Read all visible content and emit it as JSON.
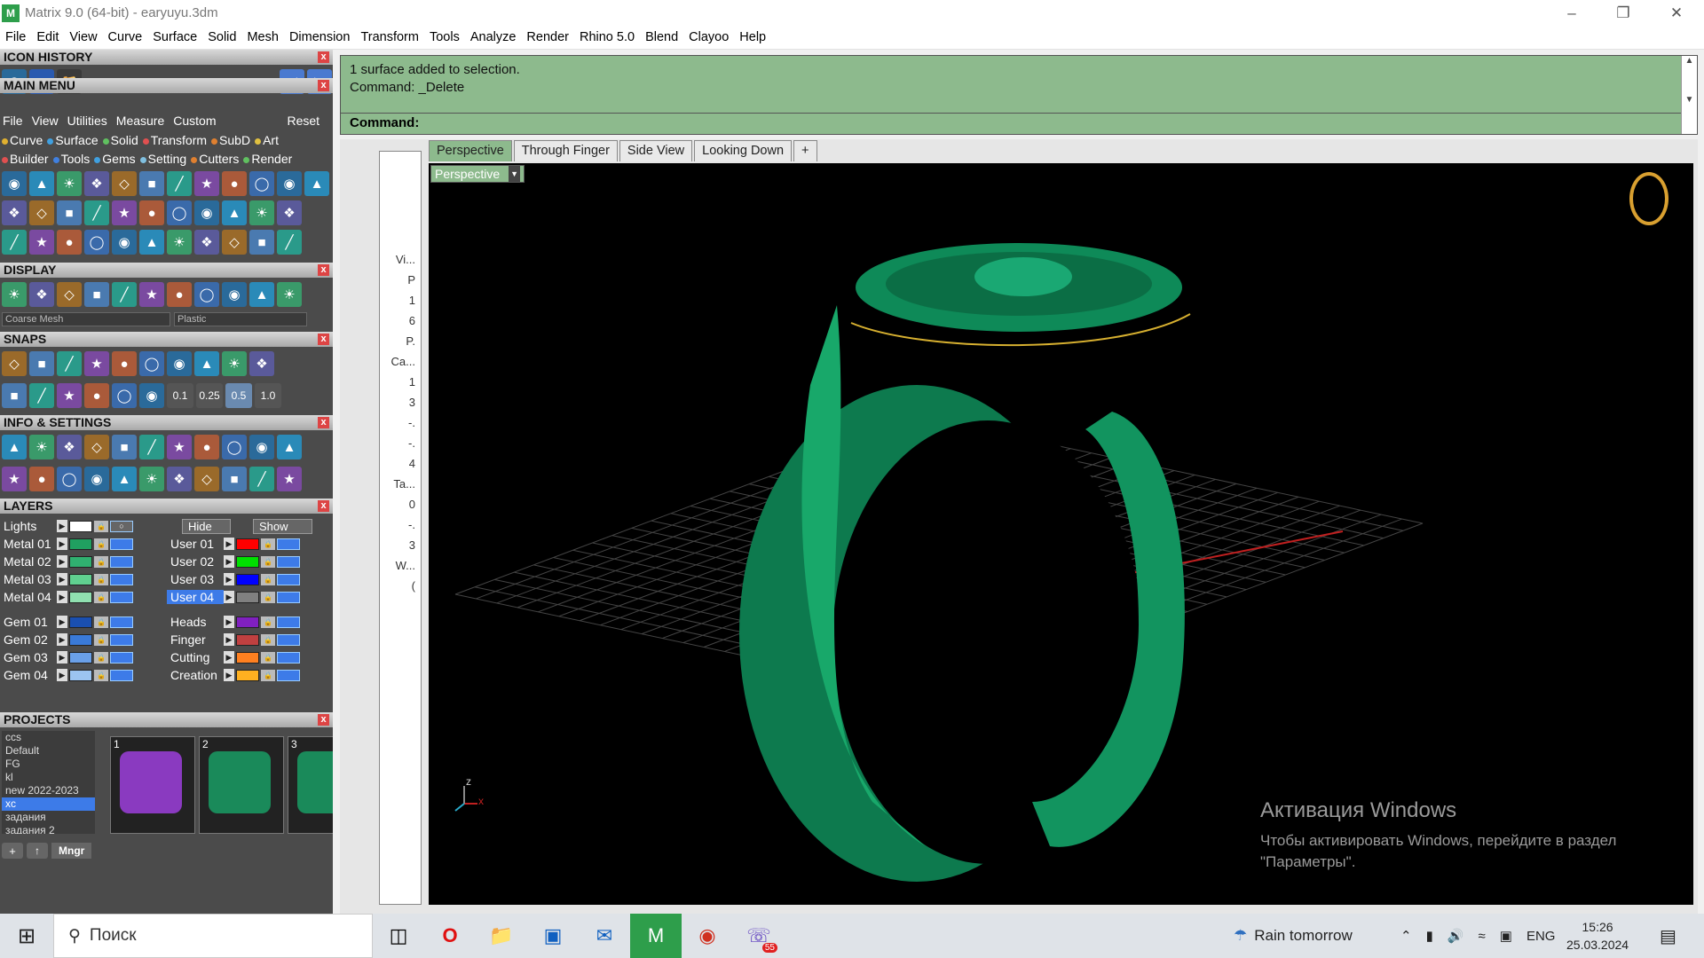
{
  "window": {
    "title": "Matrix 9.0 (64-bit) - earyuyu.3dm",
    "app_icon": "M"
  },
  "menubar": [
    "File",
    "Edit",
    "View",
    "Curve",
    "Surface",
    "Solid",
    "Mesh",
    "Dimension",
    "Transform",
    "Tools",
    "Analyze",
    "Render",
    "Rhino 5.0",
    "Blend",
    "Clayoo",
    "Help"
  ],
  "panels": {
    "icon_history": "ICON HISTORY",
    "main_menu": "MAIN MENU",
    "display": "DISPLAY",
    "snaps": "SNAPS",
    "info": "INFO & SETTINGS",
    "layers": "LAYERS",
    "projects": "PROJECTS"
  },
  "main_menu_items": [
    "File",
    "View",
    "Utilities",
    "Measure",
    "Custom",
    "Reset"
  ],
  "categories_row1": [
    {
      "label": "Curve",
      "color": "#e0b030"
    },
    {
      "label": "Surface",
      "color": "#40a0e0"
    },
    {
      "label": "Solid",
      "color": "#60c060"
    },
    {
      "label": "Transform",
      "color": "#e05050"
    },
    {
      "label": "SubD",
      "color": "#e08030"
    },
    {
      "label": "Art",
      "color": "#e0c040"
    }
  ],
  "categories_row2": [
    {
      "label": "Builder",
      "color": "#e05050"
    },
    {
      "label": "Tools",
      "color": "#4080e0"
    },
    {
      "label": "Gems",
      "color": "#40a0e0"
    },
    {
      "label": "Setting",
      "color": "#80c0e0"
    },
    {
      "label": "Cutters",
      "color": "#e08030"
    },
    {
      "label": "Render",
      "color": "#60c060"
    }
  ],
  "display": {
    "mesh": "Coarse Mesh",
    "material": "Plastic"
  },
  "snaps": {
    "values": [
      "0.1",
      "0.25",
      "0.5",
      "1.0"
    ]
  },
  "layers": {
    "lights": "Lights",
    "hide": "Hide",
    "show": "Show",
    "left": [
      {
        "name": "Metal 01",
        "color": "#20a060"
      },
      {
        "name": "Metal 02",
        "color": "#30b070"
      },
      {
        "name": "Metal 03",
        "color": "#60d090"
      },
      {
        "name": "Metal 04",
        "color": "#90e0b0"
      },
      {
        "name": "Gem 01",
        "color": "#1a4fb0"
      },
      {
        "name": "Gem 02",
        "color": "#3a7ad8"
      },
      {
        "name": "Gem 03",
        "color": "#6aa0e8"
      },
      {
        "name": "Gem 04",
        "color": "#9cc4f0"
      }
    ],
    "right": [
      {
        "name": "User 01",
        "color": "#ff0000"
      },
      {
        "name": "User 02",
        "color": "#00e000"
      },
      {
        "name": "User 03",
        "color": "#0000ff"
      },
      {
        "name": "User 04",
        "color": "#808080"
      },
      {
        "name": "Heads",
        "color": "#8020c0"
      },
      {
        "name": "Finger",
        "color": "#c04040"
      },
      {
        "name": "Cutting",
        "color": "#ff8020"
      },
      {
        "name": "Creation",
        "color": "#ffb020"
      }
    ]
  },
  "projects": {
    "list": [
      "ccs",
      "Default",
      "FG",
      "kl",
      "new 2022-2023",
      "xc",
      "задания",
      "задания 2"
    ],
    "thumbs": [
      "1",
      "2",
      "3"
    ],
    "mngr": "Mngr"
  },
  "command": {
    "history": [
      "1 surface added to selection.",
      "Command: _Delete"
    ],
    "prompt": "Command:"
  },
  "side_labels": [
    "Vi...",
    "P",
    "1",
    "6",
    "P.",
    "Ca...",
    "1",
    "3",
    "-.",
    "-.",
    "4",
    "Ta...",
    "0",
    "-.",
    "3",
    "W...",
    "("
  ],
  "tabs": [
    "Perspective",
    "Through Finger",
    "Side View",
    "Looking Down"
  ],
  "viewport": {
    "label": "Perspective",
    "axis_x": "x",
    "axis_z": "z"
  },
  "watermark": {
    "title": "Активация Windows",
    "text": "Чтобы активировать Windows, перейдите в раздел \"Параметры\"."
  },
  "taskbar": {
    "search": "Поиск",
    "weather": "Rain tomorrow",
    "lang": "ENG",
    "time": "15:26",
    "date": "25.03.2024",
    "badge": "55"
  }
}
